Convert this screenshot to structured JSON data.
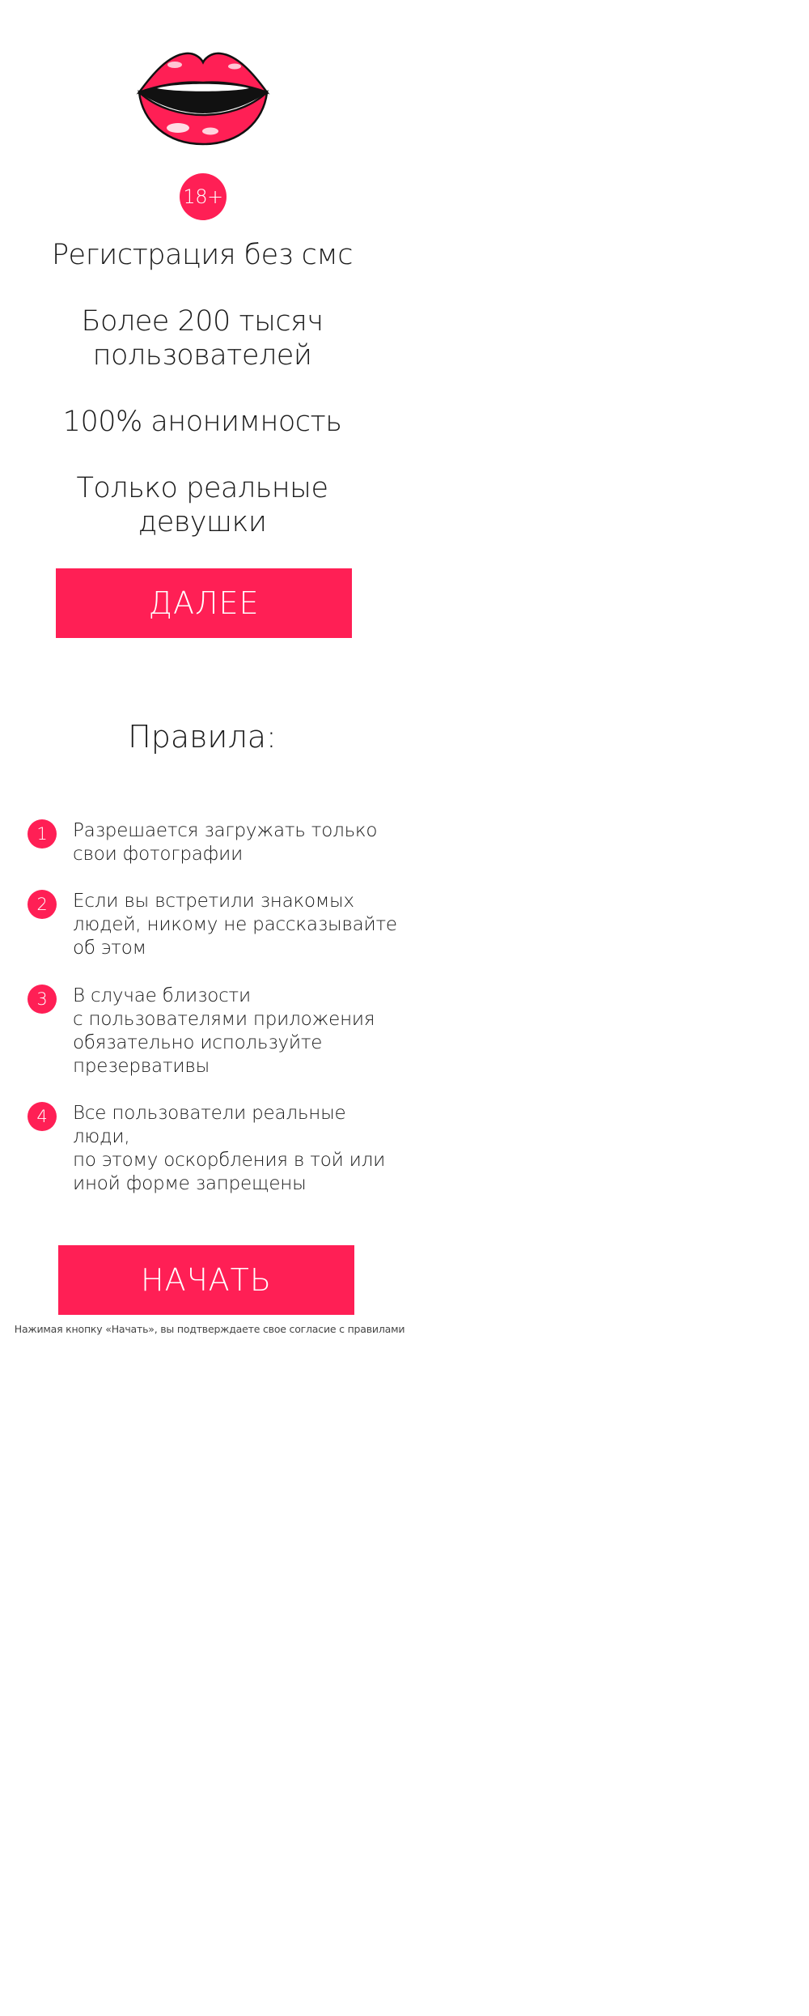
{
  "colors": {
    "accent": "#ff1f55",
    "text": "#1a1a1a",
    "background": "#ffffff"
  },
  "logo": {
    "icon": "lips-icon"
  },
  "age_badge": "18+",
  "features": [
    "Регистрация без смс",
    "Более 200 тысяч\nпользователей",
    "100% анонимность",
    "Только реальные\nдевушки"
  ],
  "next_button": "ДАЛЕЕ",
  "rules": {
    "title": "Правила:",
    "items": [
      {
        "number": "1",
        "text": "Разрешается загружать только\nсвои фотографии"
      },
      {
        "number": "2",
        "text": "Если вы встретили знакомых\nлюдей, никому не рассказывайте\nоб этом"
      },
      {
        "number": "3",
        "text": "В случае близости\nс пользователями приложения\nобязательно используйте\nпрезервативы"
      },
      {
        "number": "4",
        "text": "Все пользователи реальные люди,\nпо этому оскорбления в той или\nиной форме запрещены"
      }
    ]
  },
  "start_button": "НАЧАТЬ",
  "consent_note": "Нажимая кнопку «Начать», вы подтверждаете свое согласие с правилами"
}
